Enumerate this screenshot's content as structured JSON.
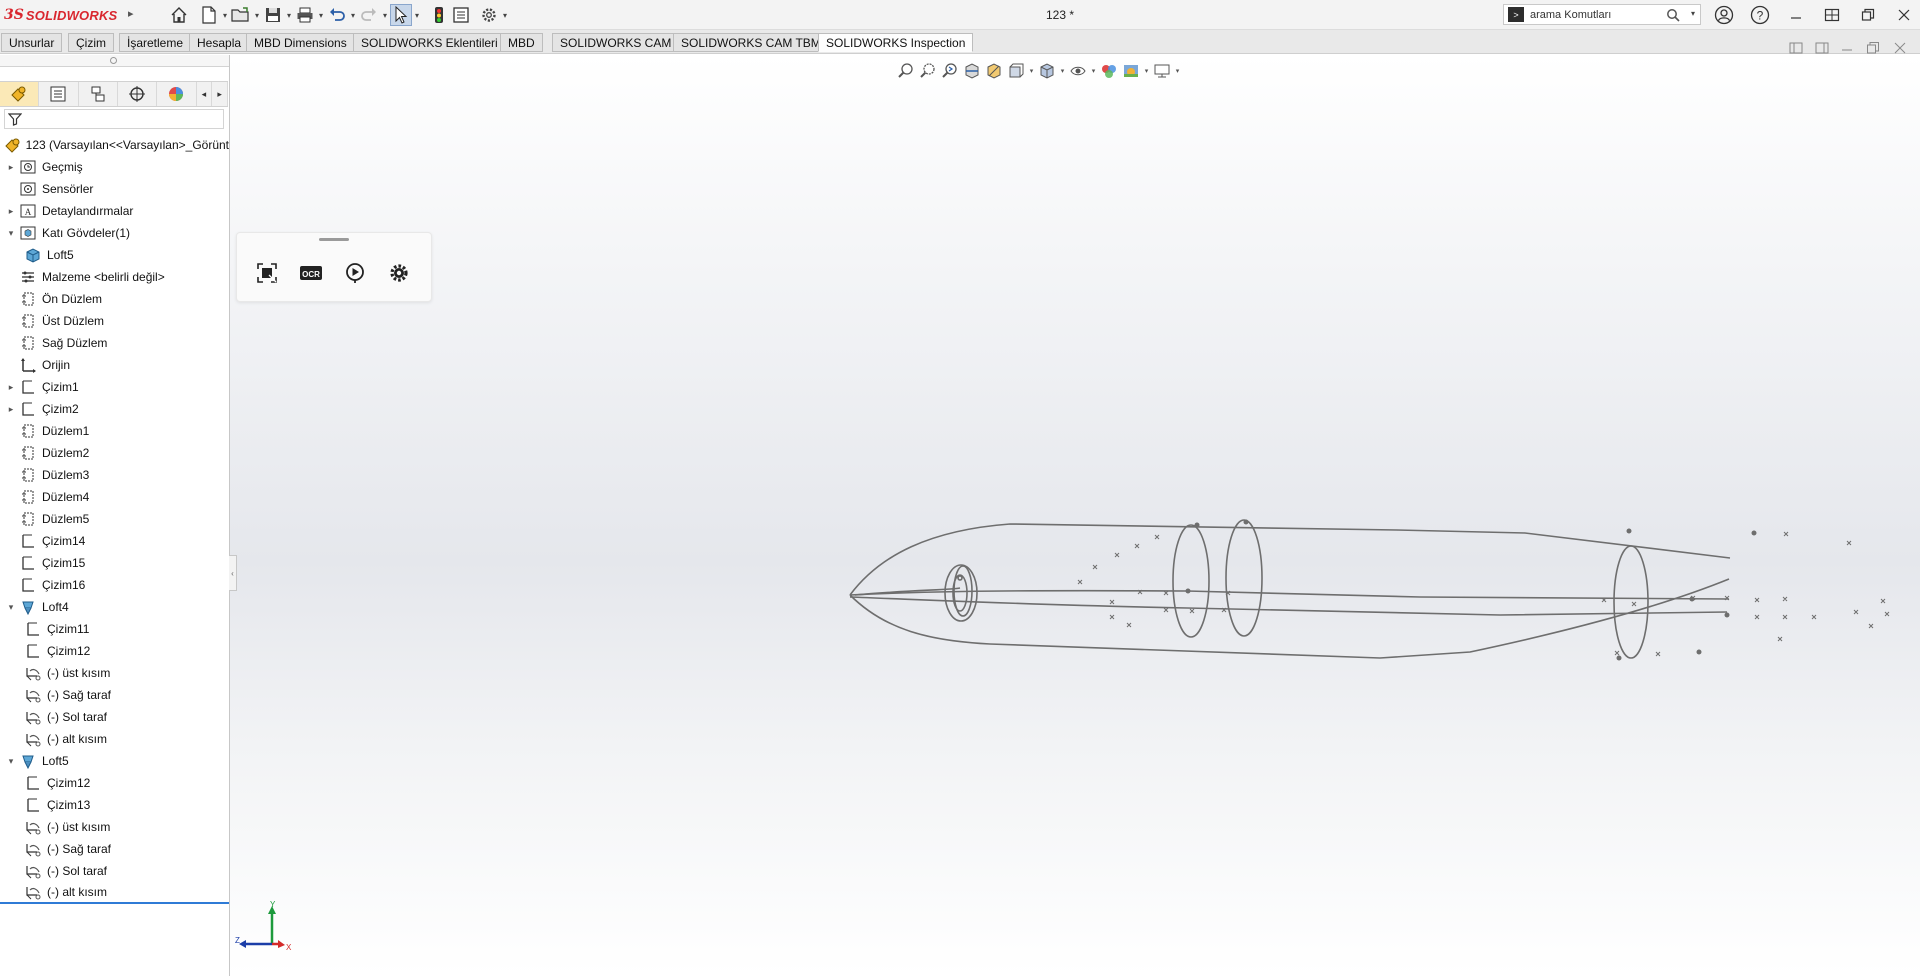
{
  "app": {
    "logo_prefix": "3S",
    "logo_text": "SOLIDWORKS",
    "document_title": "123 *"
  },
  "search": {
    "value": "arama Komutları"
  },
  "command_tabs": [
    {
      "label": "Unsurlar"
    },
    {
      "label": "Çizim"
    },
    {
      "label": "İşaretleme"
    },
    {
      "label": "Hesapla"
    },
    {
      "label": "MBD Dimensions"
    },
    {
      "label": "SOLIDWORKS Eklentileri"
    },
    {
      "label": "MBD"
    },
    {
      "label": "SOLIDWORKS CAM"
    },
    {
      "label": "SOLIDWORKS CAM TBM"
    },
    {
      "label": "SOLIDWORKS Inspection"
    }
  ],
  "tree": {
    "root": "123  (Varsayılan<<Varsayılan>_Görünt",
    "items": [
      {
        "label": "Geçmiş",
        "icon": "history-folder-icon"
      },
      {
        "label": "Sensörler",
        "icon": "sensor-icon"
      },
      {
        "label": "Detaylandırmalar",
        "icon": "annotation-icon"
      },
      {
        "label": "Katı Gövdeler(1)",
        "icon": "solid-bodies-folder-icon"
      },
      {
        "label": "Loft5",
        "icon": "solid-body-icon"
      },
      {
        "label": "Malzeme <belirli değil>",
        "icon": "material-icon"
      },
      {
        "label": "Ön Düzlem",
        "icon": "plane-icon"
      },
      {
        "label": "Üst Düzlem",
        "icon": "plane-icon"
      },
      {
        "label": "Sağ Düzlem",
        "icon": "plane-icon"
      },
      {
        "label": "Orijin",
        "icon": "origin-icon"
      },
      {
        "label": "Çizim1",
        "icon": "sketch-icon"
      },
      {
        "label": "Çizim2",
        "icon": "sketch-icon"
      },
      {
        "label": "Düzlem1",
        "icon": "plane-icon"
      },
      {
        "label": "Düzlem2",
        "icon": "plane-icon"
      },
      {
        "label": "Düzlem3",
        "icon": "plane-icon"
      },
      {
        "label": "Düzlem4",
        "icon": "plane-icon"
      },
      {
        "label": "Düzlem5",
        "icon": "plane-icon"
      },
      {
        "label": "Çizim14",
        "icon": "sketch-icon"
      },
      {
        "label": "Çizim15",
        "icon": "sketch-icon"
      },
      {
        "label": "Çizim16",
        "icon": "sketch-icon"
      },
      {
        "label": "Loft4",
        "icon": "loft-icon"
      },
      {
        "label": "Çizim11",
        "icon": "sketch-icon"
      },
      {
        "label": "Çizim12",
        "icon": "sketch-icon"
      },
      {
        "label": "(-) üst kısım",
        "icon": "3d-sketch-icon"
      },
      {
        "label": "(-) Sağ taraf",
        "icon": "3d-sketch-icon"
      },
      {
        "label": "(-) Sol taraf",
        "icon": "3d-sketch-icon"
      },
      {
        "label": "(-) alt kısım",
        "icon": "3d-sketch-icon"
      },
      {
        "label": "Loft5",
        "icon": "loft-icon"
      },
      {
        "label": "Çizim12",
        "icon": "sketch-icon"
      },
      {
        "label": "Çizim13",
        "icon": "sketch-icon"
      },
      {
        "label": "(-) üst kısım",
        "icon": "3d-sketch-icon"
      },
      {
        "label": "(-) Sağ taraf",
        "icon": "3d-sketch-icon"
      },
      {
        "label": "(-) Sol taraf",
        "icon": "3d-sketch-icon"
      },
      {
        "label": "(-) alt kısım",
        "icon": "3d-sketch-icon"
      }
    ]
  },
  "floating_toolbar": {
    "ocr_label": "OCR"
  },
  "triad": {
    "y_label": "Y",
    "z_label": "Z",
    "x_label": "X"
  },
  "colors": {
    "brand_red": "#d9262e",
    "selection_blue": "#2f7bd6",
    "wireframe": "#6e6e6e"
  }
}
